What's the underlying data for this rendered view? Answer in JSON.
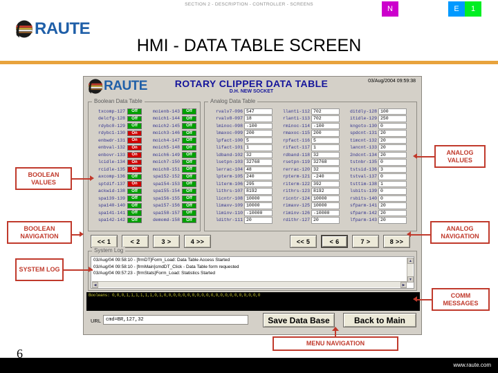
{
  "slide": {
    "section_path": "SECTION 2 - DESCRIPTION - CONTROLLER - SCREENS",
    "title": "HMI - DATA TABLE SCREEN",
    "page_number": "6",
    "footer_url": "www.raute.com",
    "brand_name": "RAUTE",
    "badges": [
      {
        "label": "N",
        "color": "#cc00cc"
      },
      {
        "label": "E",
        "color": "#0099ff"
      },
      {
        "label": "1",
        "color": "#00ee22"
      }
    ],
    "accent_color": "#e8a33d",
    "callout_color": "#c0392b"
  },
  "hmi": {
    "brand_name": "RAUTE",
    "title": "ROTARY CLIPPER DATA TABLE",
    "subtitle": "D.H. NEW SOCKET",
    "clock": "03/Aug/2004 09:59:38",
    "boolean_group_label": "Boolean Data Table",
    "analog_group_label": "Analog Data Table",
    "log_group_label": "System Log",
    "url_label": "URL",
    "url_value": "cmd=BR,127,32",
    "save_button": "Save Data Base",
    "back_button": "Back to Main",
    "comm_message": "Booleans: 0,0,0,1,1,1,1,1,1,0,1,0,0,0,0,0,0,0,0,0,0,0,0,0,0,0,0,0,0,0,0,0",
    "boolean_columns": [
      [
        {
          "name": "txcomp-127",
          "state": "Off"
        },
        {
          "name": "delcfg-128",
          "state": "Off"
        },
        {
          "name": "rdybc0-129",
          "state": "Off"
        },
        {
          "name": "rdybc1-130",
          "state": "On"
        },
        {
          "name": "enbwdr-131",
          "state": "On"
        },
        {
          "name": "enbval-132",
          "state": "On"
        },
        {
          "name": "enbovr-133",
          "state": "On"
        },
        {
          "name": "lcidle-134",
          "state": "On"
        },
        {
          "name": "rcidle-135",
          "state": "On"
        },
        {
          "name": "axcomp-136",
          "state": "Off"
        },
        {
          "name": "sptdif-137",
          "state": "On"
        },
        {
          "name": "ackwid-138",
          "state": "Off"
        },
        {
          "name": "spa139-139",
          "state": "Off"
        },
        {
          "name": "spa140-140",
          "state": "Off"
        },
        {
          "name": "spa141-141",
          "state": "Off"
        },
        {
          "name": "spa142-142",
          "state": "Off"
        }
      ],
      [
        {
          "name": "moienb-143",
          "state": "Off"
        },
        {
          "name": "moich1-144",
          "state": "Off"
        },
        {
          "name": "moich2-145",
          "state": "Off"
        },
        {
          "name": "moich3-146",
          "state": "Off"
        },
        {
          "name": "moich4-147",
          "state": "Off"
        },
        {
          "name": "moich5-148",
          "state": "Off"
        },
        {
          "name": "moich6-149",
          "state": "Off"
        },
        {
          "name": "moich7-150",
          "state": "Off"
        },
        {
          "name": "moich8-151",
          "state": "Off"
        },
        {
          "name": "spa152-152",
          "state": "Off"
        },
        {
          "name": "spa154-153",
          "state": "Off"
        },
        {
          "name": "spa155-154",
          "state": "Off"
        },
        {
          "name": "spa156-155",
          "state": "Off"
        },
        {
          "name": "spa157-156",
          "state": "Off"
        },
        {
          "name": "spa158-157",
          "state": "Off"
        },
        {
          "name": "demomd-158",
          "state": "Off"
        }
      ]
    ],
    "analog_columns": [
      [
        {
          "name": "rvalv7-096",
          "value": "547"
        },
        {
          "name": "rvalv8-097",
          "value": "18"
        },
        {
          "name": "lminoc-098",
          "value": "-100"
        },
        {
          "name": "lmaxoc-099",
          "value": "200"
        },
        {
          "name": "lpfact-100",
          "value": "5"
        },
        {
          "name": "lifact-101",
          "value": "1"
        },
        {
          "name": "ldband-102",
          "value": "32"
        },
        {
          "name": "lsetpn-103",
          "value": "32768"
        },
        {
          "name": "lerrac-104",
          "value": "48"
        },
        {
          "name": "lpterm-105",
          "value": "240"
        },
        {
          "name": "literm-106",
          "value": "295"
        },
        {
          "name": "lithrs-107",
          "value": "8192"
        },
        {
          "name": "licntr-108",
          "value": "10000"
        },
        {
          "name": "limaxv-109",
          "value": "10000"
        },
        {
          "name": "liminv-110",
          "value": "-10000"
        },
        {
          "name": "ldithr-111",
          "value": "20"
        }
      ],
      [
        {
          "name": "llanti-112",
          "value": "702"
        },
        {
          "name": "rlanti-113",
          "value": "702"
        },
        {
          "name": "rminoc-114",
          "value": "-100"
        },
        {
          "name": "rmaxoc-115",
          "value": "200"
        },
        {
          "name": "rpfact-116",
          "value": "5"
        },
        {
          "name": "rifact-117",
          "value": "1"
        },
        {
          "name": "rdband-118",
          "value": "32"
        },
        {
          "name": "rsetpn-119",
          "value": "32768"
        },
        {
          "name": "rerrac-120",
          "value": "32"
        },
        {
          "name": "rpterm-121",
          "value": "-240"
        },
        {
          "name": "riterm-122",
          "value": "392"
        },
        {
          "name": "rithrs-123",
          "value": "8192"
        },
        {
          "name": "ricntr-124",
          "value": "10000"
        },
        {
          "name": "rimaxv-125",
          "value": "10000"
        },
        {
          "name": "riminv-126",
          "value": "-10000"
        },
        {
          "name": "rdithr-127",
          "value": "20"
        }
      ],
      [
        {
          "name": "ditdly-128",
          "value": "100"
        },
        {
          "name": "itidle-129",
          "value": "250"
        },
        {
          "name": "kngoto-130",
          "value": "0"
        },
        {
          "name": "spdcnt-131",
          "value": "20"
        },
        {
          "name": "timcnt-132",
          "value": "20"
        },
        {
          "name": "lancnt-133",
          "value": "20"
        },
        {
          "name": "2ndcnt-134",
          "value": "20"
        },
        {
          "name": "tstnbr-135",
          "value": "0"
        },
        {
          "name": "tstsid-136",
          "value": "3"
        },
        {
          "name": "tstval-137",
          "value": "0"
        },
        {
          "name": "tsttim-138",
          "value": "1"
        },
        {
          "name": "lsbits-139",
          "value": "0"
        },
        {
          "name": "rsbits-140",
          "value": "0"
        },
        {
          "name": "sfparm-141",
          "value": "20"
        },
        {
          "name": "sfparm-142",
          "value": "20"
        },
        {
          "name": "lfparm-143",
          "value": "20"
        }
      ]
    ],
    "boolean_nav": [
      {
        "label": "<< 1",
        "selected": false
      },
      {
        "label": "< 2",
        "selected": false
      },
      {
        "label": "3 >",
        "selected": false
      },
      {
        "label": "4 >>",
        "selected": false
      }
    ],
    "analog_nav": [
      {
        "label": "<< 5",
        "selected": false
      },
      {
        "label": "< 6",
        "selected": true
      },
      {
        "label": "7 >",
        "selected": false
      },
      {
        "label": "8 >>",
        "selected": false
      }
    ],
    "log_lines": [
      "03/Aug/04 09:58:10 - [frmDT]Form_Load: Data Table Access Started",
      "03/Aug/04 09:58:10 - [frmMain]cmdDT_Click - Data Table form requested",
      "03/Aug/04 09:57:23 - [frmStats]Form_Load: Statistics Started"
    ]
  },
  "callouts": {
    "boolean_values": "BOOLEAN VALUES",
    "boolean_navigation": "BOOLEAN NAVIGATION",
    "system_log": "SYSTEM LOG",
    "analog_values": "ANALOG VALUES",
    "analog_navigation": "ANALOG NAVIGATION",
    "comm_messages": "COMM MESSAGES",
    "menu_navigation": "MENU NAVIGATION"
  }
}
